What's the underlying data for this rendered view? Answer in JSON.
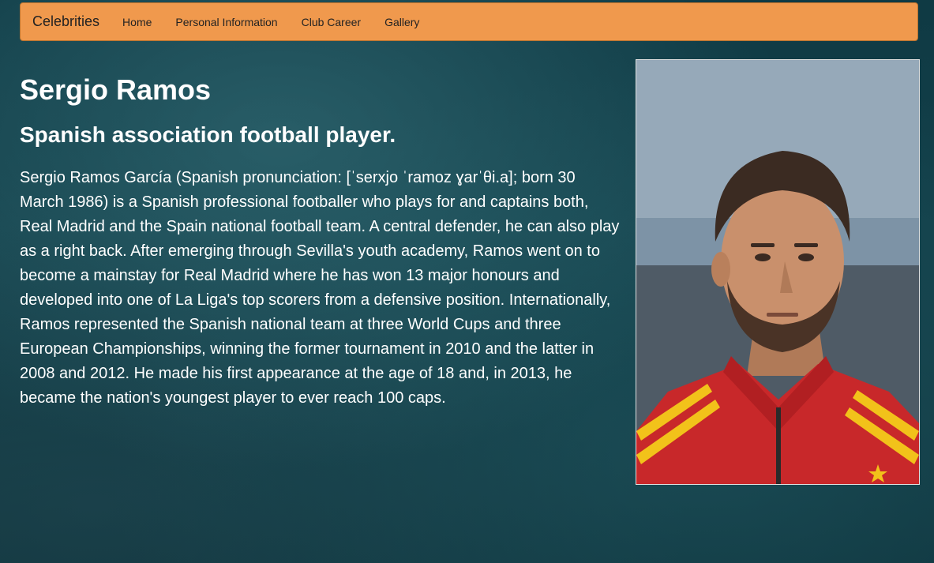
{
  "navbar": {
    "brand": "Celebrities",
    "items": [
      {
        "label": "Home"
      },
      {
        "label": "Personal Information"
      },
      {
        "label": "Club Career"
      },
      {
        "label": "Gallery"
      }
    ],
    "background_color": "#f0994d"
  },
  "main": {
    "title": "Sergio Ramos",
    "subtitle": "Spanish association football player.",
    "bio": "Sergio Ramos García (Spanish pronunciation: [ˈserxjo ˈramoz ɣarˈθi.a]; born 30 March 1986) is a Spanish professional footballer who plays for and captains both, Real Madrid and the Spain national football team. A central defender, he can also play as a right back. After emerging through Sevilla's youth academy, Ramos went on to become a mainstay for Real Madrid where he has won 13 major honours and developed into one of La Liga's top scorers from a defensive position. Internationally, Ramos represented the Spanish national team at three World Cups and three European Championships, winning the former tournament in 2010 and the latter in 2008 and 2012. He made his first appearance at the age of 18 and, in 2013, he became the nation's youngest player to ever reach 100 caps."
  },
  "photo": {
    "subject": "portrait-photo",
    "jersey_color": "#c8282a",
    "stripe_color": "#f2c21a"
  }
}
